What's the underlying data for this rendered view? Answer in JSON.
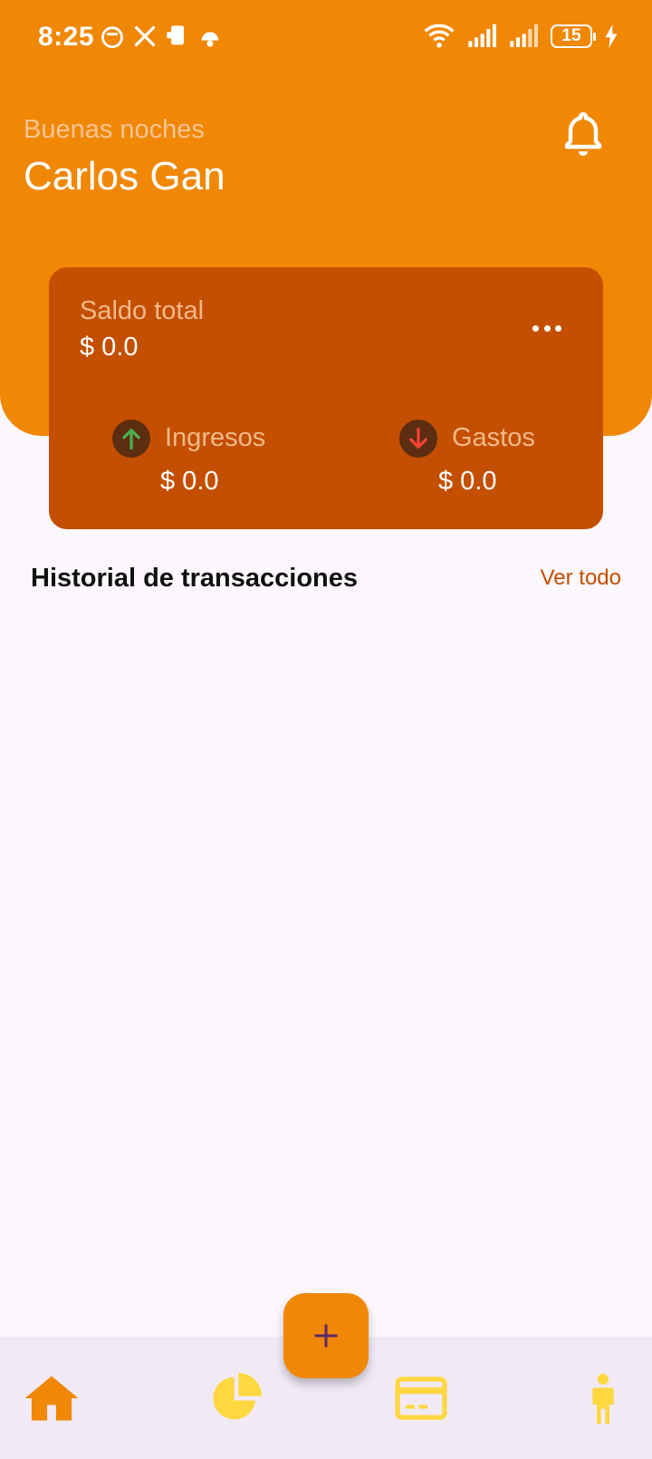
{
  "status_bar": {
    "time": "8:25",
    "battery_level": "15",
    "icons_left": [
      "face-icon",
      "x-logo-icon",
      "phone-icon",
      "android-icon"
    ],
    "icons_right": [
      "wifi-icon",
      "signal-icon",
      "signal-icon",
      "battery-icon",
      "charging-icon"
    ]
  },
  "header": {
    "greeting": "Buenas noches",
    "username": "Carlos Gan",
    "notification_icon": "bell-icon"
  },
  "balance_card": {
    "label": "Saldo total",
    "value": "$ 0.0",
    "more_icon": "more-horizontal-icon",
    "income": {
      "label": "Ingresos",
      "value": "$ 0.0",
      "icon": "arrow-up-icon"
    },
    "expenses": {
      "label": "Gastos",
      "value": "$ 0.0",
      "icon": "arrow-down-icon"
    }
  },
  "transactions": {
    "title": "Historial de transacciones",
    "see_all": "Ver todo",
    "items": []
  },
  "bottom_nav": {
    "items": [
      {
        "icon": "home-icon",
        "active": true
      },
      {
        "icon": "pie-chart-icon",
        "active": false
      },
      {
        "icon": "credit-card-icon",
        "active": false
      },
      {
        "icon": "person-icon",
        "active": false
      }
    ],
    "fab_icon": "plus-icon"
  },
  "colors": {
    "primary": "#F08705",
    "card": "#C44F00",
    "background": "#FCF7FC",
    "nav_background": "#F1EAF6",
    "income": "#4CAF50",
    "expense": "#F44336",
    "nav_inactive": "#FFD740"
  }
}
